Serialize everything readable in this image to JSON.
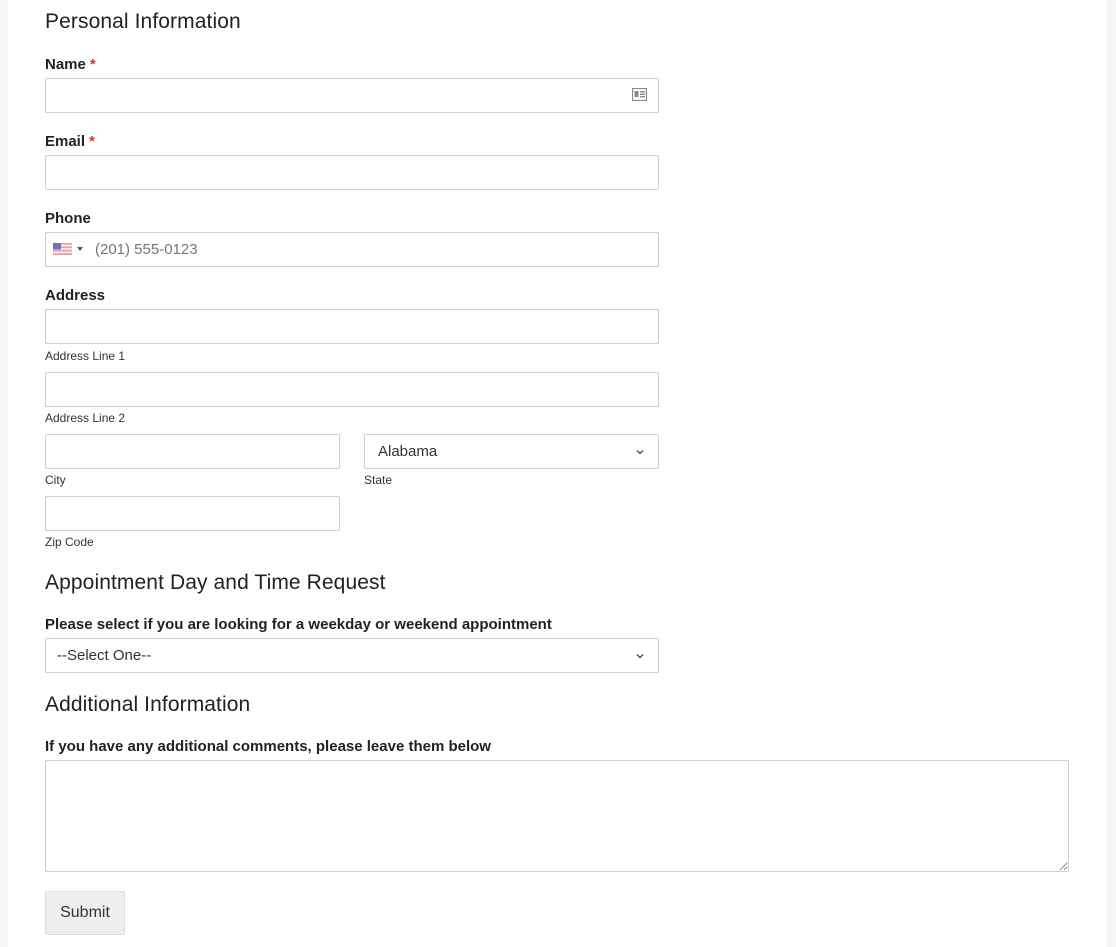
{
  "sections": {
    "personal": "Personal Information",
    "appointment": "Appointment Day and Time Request",
    "additional": "Additional Information"
  },
  "fields": {
    "name": {
      "label": "Name",
      "required_mark": "*",
      "value": "",
      "icon": "contact-card-icon"
    },
    "email": {
      "label": "Email",
      "required_mark": "*",
      "value": ""
    },
    "phone": {
      "label": "Phone",
      "country_flag": "us-flag-icon",
      "placeholder": "(201) 555-0123",
      "value": ""
    },
    "address": {
      "label": "Address",
      "line1": {
        "value": "",
        "sublabel": "Address Line 1"
      },
      "line2": {
        "value": "",
        "sublabel": "Address Line 2"
      },
      "city": {
        "value": "",
        "sublabel": "City"
      },
      "state": {
        "selected": "Alabama",
        "sublabel": "State"
      },
      "zip": {
        "value": "",
        "sublabel": "Zip Code"
      }
    },
    "appointment_type": {
      "label": "Please select if you are looking for a weekday or weekend appointment",
      "selected": "--Select One--"
    },
    "comments": {
      "label": "If you have any additional comments, please leave them below",
      "value": ""
    }
  },
  "buttons": {
    "submit": "Submit"
  },
  "colors": {
    "required": "#d63637",
    "border": "#cfcfcf",
    "button_bg": "#eeeeee"
  }
}
